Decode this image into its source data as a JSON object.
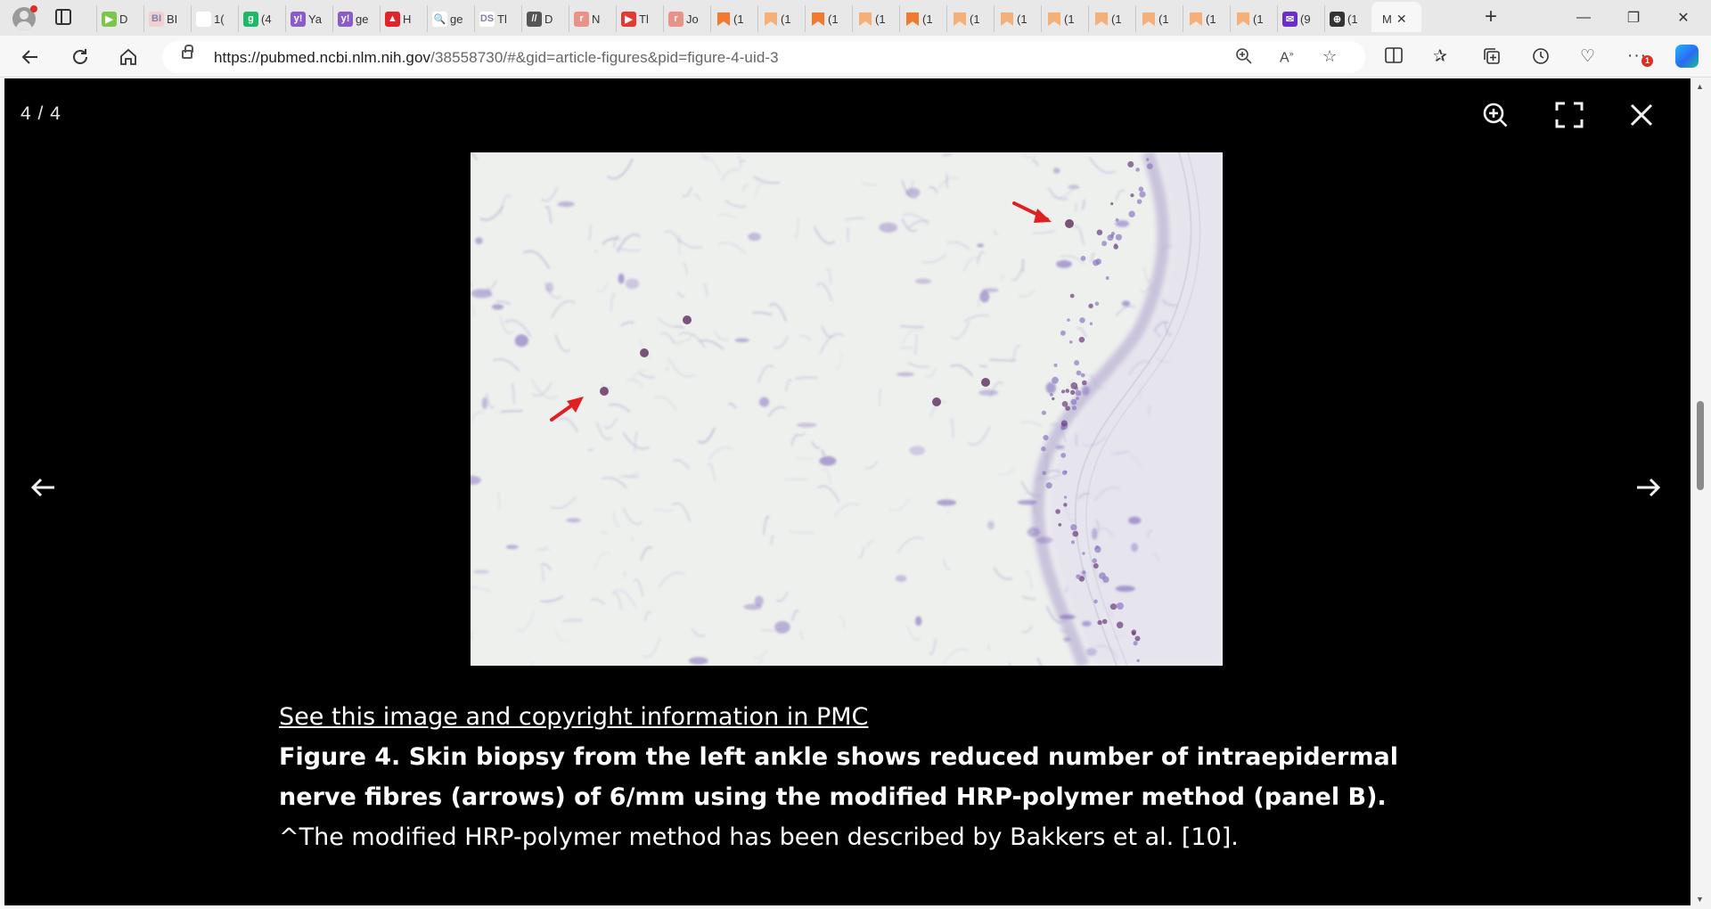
{
  "browser": {
    "tabs": [
      {
        "label": "D",
        "icon": "play-icon",
        "color": "#7cc74a",
        "glyph": "▶"
      },
      {
        "label": "BI",
        "icon": "bi-icon",
        "color": "#f0d0d0",
        "glyph": "BI"
      },
      {
        "label": "1(",
        "icon": "generic-page-icon",
        "color": "#ffffff",
        "glyph": ""
      },
      {
        "label": "(4",
        "icon": "g-icon",
        "color": "#1fb866",
        "glyph": "g"
      },
      {
        "label": "Ya",
        "icon": "yahoo-icon",
        "color": "#8a5cc7",
        "glyph": "y!"
      },
      {
        "label": "ge",
        "icon": "yahoo-icon",
        "color": "#8a5cc7",
        "glyph": "y!"
      },
      {
        "label": "H",
        "icon": "red-shield-icon",
        "color": "#e0242a",
        "glyph": "▲"
      },
      {
        "label": "ge",
        "icon": "search-icon",
        "color": "#ffffff",
        "glyph": "🔍"
      },
      {
        "label": "Tl",
        "icon": "ds-icon",
        "color": "#ffffff",
        "glyph": "DS"
      },
      {
        "label": "D",
        "icon": "stripes-icon",
        "color": "#555555",
        "glyph": "//"
      },
      {
        "label": "N",
        "icon": "r-icon",
        "color": "#e8928a",
        "glyph": "r"
      },
      {
        "label": "Tl",
        "icon": "youtube-icon",
        "color": "#e53935",
        "glyph": "▶"
      },
      {
        "label": "Jo",
        "icon": "r-icon",
        "color": "#e8928a",
        "glyph": "r"
      },
      {
        "label": "(1",
        "icon": "bookmark-icon",
        "color": "#f07a30",
        "glyph": ""
      },
      {
        "label": "(1",
        "icon": "bookmark-icon",
        "color": "#f5b07a",
        "glyph": ""
      },
      {
        "label": "(1",
        "icon": "bookmark-icon",
        "color": "#f07a30",
        "glyph": ""
      },
      {
        "label": "(1",
        "icon": "bookmark-icon",
        "color": "#f5b07a",
        "glyph": ""
      },
      {
        "label": "(1",
        "icon": "bookmark-icon",
        "color": "#f07a30",
        "glyph": ""
      },
      {
        "label": "(1",
        "icon": "bookmark-icon",
        "color": "#f5b07a",
        "glyph": ""
      },
      {
        "label": "(1",
        "icon": "bookmark-icon",
        "color": "#f5b07a",
        "glyph": ""
      },
      {
        "label": "(1",
        "icon": "bookmark-icon",
        "color": "#f5b07a",
        "glyph": ""
      },
      {
        "label": "(1",
        "icon": "bookmark-icon",
        "color": "#f5b07a",
        "glyph": ""
      },
      {
        "label": "(1",
        "icon": "bookmark-icon",
        "color": "#f5b07a",
        "glyph": ""
      },
      {
        "label": "(1",
        "icon": "bookmark-icon",
        "color": "#f5b07a",
        "glyph": ""
      },
      {
        "label": "(1",
        "icon": "bookmark-icon",
        "color": "#f5b07a",
        "glyph": ""
      },
      {
        "label": "(9",
        "icon": "mail-icon",
        "color": "#6b2fc7",
        "glyph": "✉"
      },
      {
        "label": "(1",
        "icon": "sudoku-icon",
        "color": "#333333",
        "glyph": "⊕"
      }
    ],
    "active_tab": {
      "label": "M",
      "icon": "pubmed-icon",
      "close_glyph": "✕"
    },
    "new_tab_glyph": "+",
    "window": {
      "minimize": "—",
      "restore": "❐",
      "close": "✕"
    },
    "url_host": "https://pubmed.ncbi.nlm.nih.gov",
    "url_path": "/38558730/#&gid=article-figures&pid=figure-4-uid-3",
    "badge_count": "1"
  },
  "viewer": {
    "counter": "4 / 4",
    "zoom_glyph": "⊕",
    "fullscreen_glyph": "⛶",
    "close_glyph": "✕",
    "prev_glyph": "←",
    "next_glyph": "→",
    "link_text": "See this image and copyright information in PMC",
    "figure_title": "Figure 4. Skin biopsy from the left ankle shows reduced number of intraepidermal nerve fibres (arrows) of 6/mm using the modified HRP-polymer method (panel B).",
    "figure_note": "^The modified HRP-polymer method has been described by Bakkers et al. [10].",
    "image_colors": {
      "background": "#eef0ee",
      "stain": "#7a62b8",
      "arrow": "#e02020"
    }
  }
}
